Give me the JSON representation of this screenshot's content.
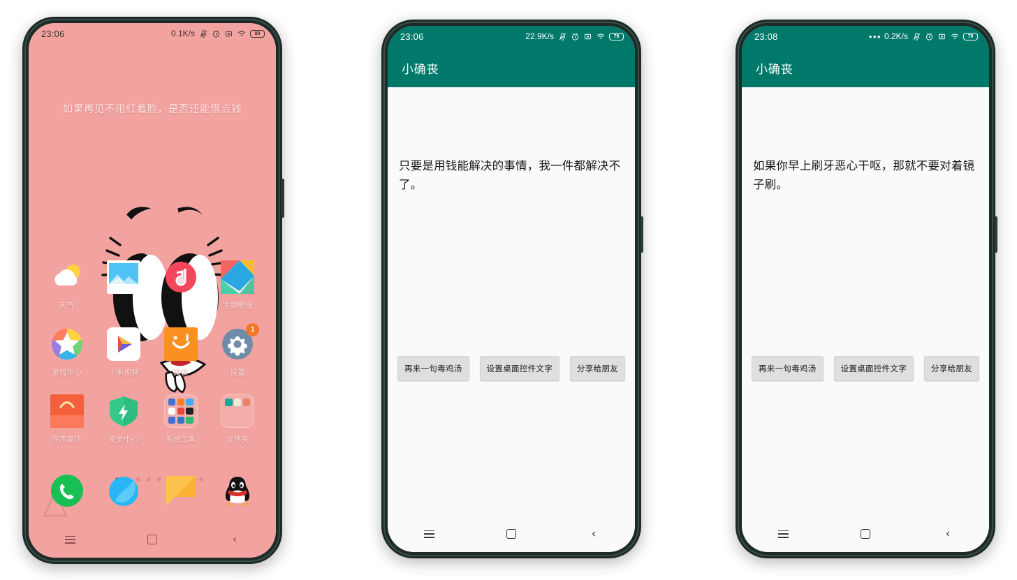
{
  "scene": {
    "description": "Three Android phone mockups: MIUI home screen and two screens of the app 小确丧",
    "page_background": "#ffffff",
    "wallpaper_color": "#f2a3a0",
    "accent_teal": "#00796b",
    "badge_color": "#f5762a"
  },
  "phone1": {
    "status_bar": {
      "clock": "23:06",
      "network_speed": "0.1K/s",
      "icons": [
        "mute-icon",
        "alarm-icon",
        "no-sim-icon",
        "wifi-icon",
        "battery-icon"
      ],
      "battery_level": "80"
    },
    "widget": {
      "text": "如果再见不用红着脸，是否还能借点钱"
    },
    "apps": [
      {
        "label": "天气",
        "icon": "weather-icon"
      },
      {
        "label": "",
        "icon": "gallery-icon"
      },
      {
        "label": "",
        "icon": "music-icon"
      },
      {
        "label": "主题壁纸",
        "icon": "themes-icon"
      },
      {
        "label": "游戏中心",
        "icon": "game-center-icon"
      },
      {
        "label": "小米视频",
        "icon": "mi-video-icon"
      },
      {
        "label": "阅读",
        "icon": "reading-icon"
      },
      {
        "label": "设置",
        "icon": "settings-icon",
        "badge": "1"
      },
      {
        "label": "应用商店",
        "icon": "app-store-icon"
      },
      {
        "label": "安全中心",
        "icon": "security-center-icon"
      },
      {
        "label": "系统工具",
        "icon": "system-tools-folder-icon"
      },
      {
        "label": "文件夹",
        "icon": "folder-icon"
      }
    ],
    "page_indicator": {
      "pages": 9,
      "active": 1
    },
    "dock": [
      {
        "label": "",
        "icon": "phone-icon"
      },
      {
        "label": "",
        "icon": "browser-icon"
      },
      {
        "label": "",
        "icon": "messages-icon"
      },
      {
        "label": "",
        "icon": "qq-icon"
      }
    ],
    "nav_bar": {
      "recents": "recents-icon",
      "home": "home-icon",
      "back": "back-icon"
    }
  },
  "phone2": {
    "status_bar": {
      "clock": "23:06",
      "network_speed": "22.9K/s",
      "icons": [
        "mute-icon",
        "alarm-icon",
        "no-sim-icon",
        "wifi-icon",
        "battery-icon"
      ],
      "battery_level": "79"
    },
    "app_bar": {
      "title": "小确丧"
    },
    "quote": "只要是用钱能解决的事情，我一件都解决不了。",
    "buttons": [
      {
        "label": "再来一句毒鸡汤"
      },
      {
        "label": "设置桌面控件文字"
      },
      {
        "label": "分享给朋友"
      }
    ],
    "nav_bar": {
      "recents": "recents-icon",
      "home": "home-icon",
      "back": "back-icon"
    }
  },
  "phone3": {
    "status_bar": {
      "clock": "23:08",
      "notification_dots": "•••",
      "network_speed": "0.2K/s",
      "icons": [
        "mute-icon",
        "alarm-icon",
        "no-sim-icon",
        "wifi-icon",
        "battery-icon"
      ],
      "battery_level": "79"
    },
    "app_bar": {
      "title": "小确丧"
    },
    "quote": "如果你早上刷牙恶心干呕，那就不要对着镜子刷。",
    "buttons": [
      {
        "label": "再来一句毒鸡汤"
      },
      {
        "label": "设置桌面控件文字"
      },
      {
        "label": "分享给朋友"
      }
    ],
    "nav_bar": {
      "recents": "recents-icon",
      "home": "home-icon",
      "back": "back-icon"
    }
  }
}
